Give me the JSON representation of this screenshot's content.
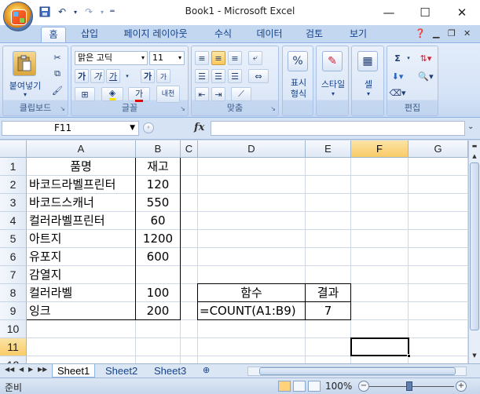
{
  "window": {
    "title": "Book1 - Microsoft Excel",
    "minimize_icon": "minimize-icon",
    "maximize_icon": "maximize-icon",
    "close_icon": "close-icon"
  },
  "ribbon_tabs": [
    "홈",
    "삽입",
    "페이지 레이아웃",
    "수식",
    "데이터",
    "검토",
    "보기"
  ],
  "ribbon": {
    "clipboard": {
      "paste_label": "붙여넣기",
      "group_label": "클립보드"
    },
    "font": {
      "font_name": "맑은 고딕",
      "font_size": "11",
      "group_label": "글꼴",
      "bold": "가",
      "italic": "가",
      "underline": "가",
      "grow": "가",
      "shrink": "가",
      "font_color_glyph": "가",
      "phonetic": "내천"
    },
    "alignment": {
      "group_label": "맞춤"
    },
    "number": {
      "label": "표시\n형식",
      "group_label": "표시 형식",
      "percent": "%"
    },
    "styles": {
      "label": "스타일"
    },
    "cells": {
      "label": "셀"
    },
    "editing": {
      "group_label": "편집",
      "sum": "Σ"
    }
  },
  "formula_bar": {
    "name_box": "F11",
    "fx": "fx",
    "value": ""
  },
  "columns": [
    "A",
    "B",
    "C",
    "D",
    "E",
    "F",
    "G"
  ],
  "selected_column": "F",
  "rows": [
    "1",
    "2",
    "3",
    "4",
    "5",
    "6",
    "7",
    "8",
    "9",
    "10",
    "11",
    "12"
  ],
  "selected_row": "11",
  "cells": {
    "A1": "품명",
    "B1": "재고",
    "A2": "바코드라벨프린터",
    "B2": "120",
    "A3": "바코드스캐너",
    "B3": "550",
    "A4": "컬러라벨프린터",
    "B4": "60",
    "A5": "아트지",
    "B5": "1200",
    "A6": "유포지",
    "B6": "600",
    "A7": "감열지",
    "B7": "",
    "A8": "컬러라벨",
    "B8": "100",
    "A9": "잉크",
    "B9": "200",
    "D8": "함수",
    "E8": "결과",
    "D9": "=COUNT(A1:B9)",
    "E9": "7"
  },
  "sheets": [
    "Sheet1",
    "Sheet2",
    "Sheet3"
  ],
  "active_sheet": "Sheet1",
  "status": {
    "ready": "준비",
    "zoom": "100%"
  }
}
